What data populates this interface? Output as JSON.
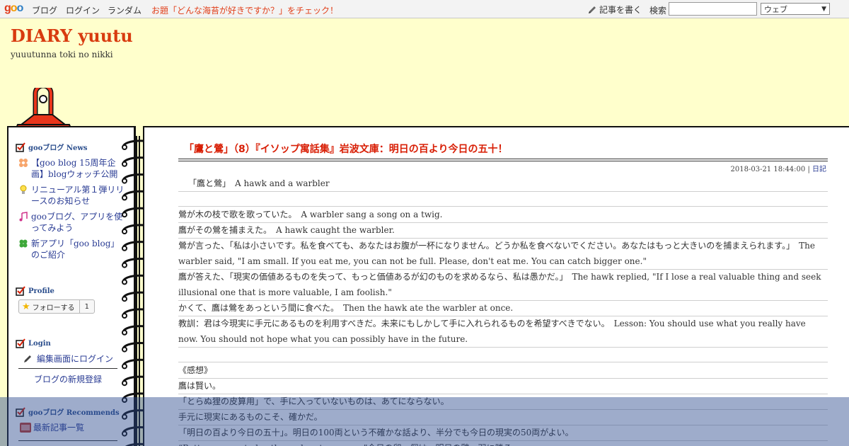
{
  "topbar": {
    "logo": [
      "g",
      "o",
      "o"
    ],
    "blog": "ブログ",
    "login": "ログイン",
    "random": "ランダム",
    "odai": "お題「どんな海苔が好きですか？」をチェック！",
    "write": "記事を書く",
    "search_label": "検索",
    "search_value": "",
    "search_scope": "ウェブ"
  },
  "header": {
    "title": "DIARY yuutu",
    "subtitle": "yuuutunna toki no nikki"
  },
  "sidebar": {
    "news_title": "gooブログ News",
    "news": [
      {
        "icon": "flower-icon",
        "text": "【goo blog 15周年企画】blogウォッチ公開"
      },
      {
        "icon": "lightbulb-icon",
        "text": "リニューアル第１弾リリースのお知らせ"
      },
      {
        "icon": "music-note-icon",
        "text": "gooブログ、アプリを使ってみよう"
      },
      {
        "icon": "clover-icon",
        "text": "新アプリ「goo blog」のご紹介"
      }
    ],
    "profile_title": "Profile",
    "follow_label": "フォローする",
    "follow_count": "1",
    "login_title": "Login",
    "login_link": "編集画面にログイン",
    "register_link": "ブログの新規登録",
    "recommends_title": "gooブログ Recommends",
    "recent_link": "最新記事一覧"
  },
  "entry": {
    "title": "「鷹と鶯」（8）『イソップ寓話集』岩波文庫：明日の百より今日の五十！",
    "date": "2018-03-21 18:44:00",
    "separator": " | ",
    "category": "日記",
    "lines": [
      "「鷹と鶯」　A hawk and a warbler",
      "",
      "鶯が木の枝で歌を歌っていた。　A warbler sang a song on a twig.",
      "鷹がその鶯を捕まえた。　A hawk caught the warbler.",
      "鶯が言った、「私は小さいです。私を食べても、あなたはお腹が一杯になりません。どうか私を食べないでください。あなたはもっと大きいのを捕まえられます。」　The warbler said, \"I am small. If you eat me, you can not be full. Please, don't eat me. You can catch bigger one.\"",
      "鷹が答えた、「現実の価値あるものを失って、もっと価値あるが幻のものを求めるなら、私は愚かだ。」　The hawk replied, \"If I lose a real valuable thing and seek illusional one that is more valuable, I am foolish.\"",
      "かくて、鷹は鶯をあっという間に食べた。　Then the hawk ate the warbler at once.",
      "教訓：君は今現実に手元にあるものを利用すべきだ。未来にもしかして手に入れられるものを希望すべきでない。　Lesson: You should use what you really have now. You should not hope what you can possibly have in the future.",
      "",
      "《感想》",
      "鷹は賢い。",
      "「とらぬ狸の皮算用」で、手に入っていないものは、あてにならない。",
      "手元に現実にあるものこそ、確かだ。",
      "「明日の百より今日の五十」。明日の100両という不確かな話より、半分でも今日の現実の50両がよい。",
      "“Better an egg today than a hen tomorrow.”今日の卵一個は、明日の鶏一羽に勝る。"
    ]
  },
  "colors": {
    "background": "#ffffcc",
    "title": "#d83b0f",
    "entry_title": "#d81e05",
    "link": "#2a3c94",
    "clip": "#e8351b"
  }
}
